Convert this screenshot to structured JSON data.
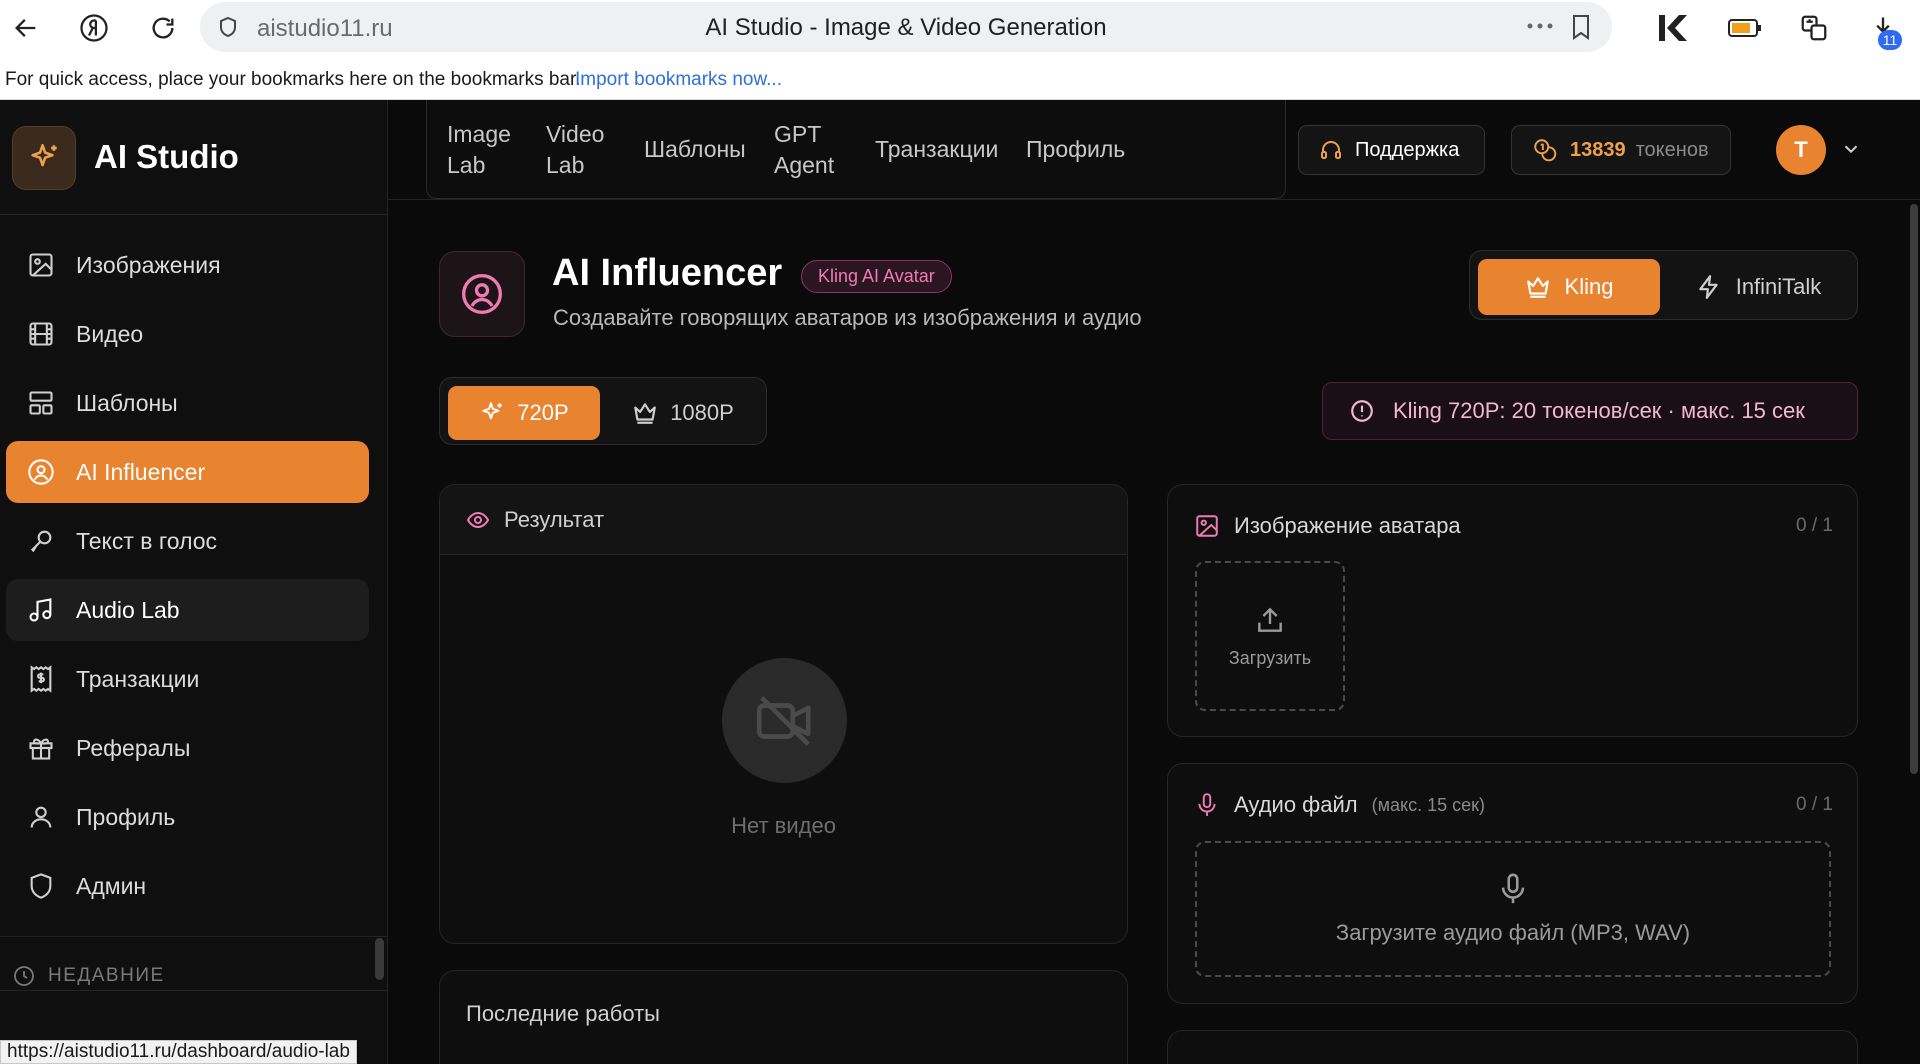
{
  "browser": {
    "url": "aistudio11.ru",
    "page_title": "AI Studio - Image & Video Generation",
    "downloads_badge": "11",
    "bookmarks_hint": "For quick access, place your bookmarks here on the bookmarks bar.",
    "bookmarks_import": "Import bookmarks now...",
    "status_url": "https://aistudio11.ru/dashboard/audio-lab"
  },
  "sidebar": {
    "brand": "AI Studio",
    "items": [
      {
        "label": "Изображения",
        "icon": "image-icon"
      },
      {
        "label": "Видео",
        "icon": "film-icon"
      },
      {
        "label": "Шаблоны",
        "icon": "layout-icon"
      },
      {
        "label": "AI Influencer",
        "icon": "user-circle-icon",
        "active": true
      },
      {
        "label": "Текст в голос",
        "icon": "mic-pen-icon"
      },
      {
        "label": "Audio Lab",
        "icon": "music-icon",
        "hover": true
      },
      {
        "label": "Транзакции",
        "icon": "receipt-icon"
      },
      {
        "label": "Рефералы",
        "icon": "gift-icon"
      },
      {
        "label": "Профиль",
        "icon": "user-icon"
      },
      {
        "label": "Админ",
        "icon": "shield-icon"
      }
    ],
    "recent_heading": "НЕДАВНИЕ"
  },
  "topnav": {
    "items": [
      {
        "label": "Image Lab"
      },
      {
        "label": "Video Lab"
      },
      {
        "label": "Шаблоны"
      },
      {
        "label": "GPT Agent"
      },
      {
        "label": "Транзакции"
      },
      {
        "label": "Профиль"
      }
    ],
    "support_label": "Поддержка",
    "tokens_count": "13839",
    "tokens_unit": "токенов",
    "avatar_initial": "T"
  },
  "main": {
    "title": "AI Influencer",
    "badge": "Kling AI Avatar",
    "subtitle": "Создавайте говорящих аватаров из изображения и аудио",
    "models": [
      {
        "label": "Kling",
        "selected": true
      },
      {
        "label": "InfiniTalk",
        "selected": false
      }
    ],
    "resolutions": [
      {
        "label": "720P",
        "selected": true
      },
      {
        "label": "1080P",
        "selected": false
      }
    ],
    "price_note": "Kling 720P: 20 токенов/сек · макс. 15 сек",
    "result": {
      "title": "Результат",
      "empty_text": "Нет видео"
    },
    "recent_works_title": "Последние работы",
    "avatar_upload": {
      "title": "Изображение аватара",
      "counter": "0 / 1",
      "button": "Загрузить"
    },
    "audio_upload": {
      "title": "Аудио файл",
      "hint": "(макс. 15 сек)",
      "counter": "0 / 1",
      "drop_text": "Загрузите аудио файл (MP3, WAV)"
    }
  },
  "colors": {
    "accent": "#e8832f",
    "pink": "#f07ab4",
    "background": "#0a0a0a"
  }
}
